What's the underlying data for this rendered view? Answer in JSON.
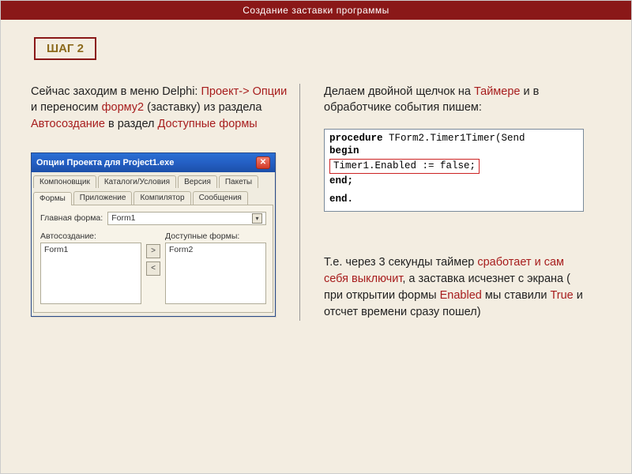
{
  "header": {
    "title": "Создание заставки программы"
  },
  "step": {
    "label": "ШАГ 2"
  },
  "left": {
    "p1": {
      "t0": " Сейчас заходим в меню Delphi: ",
      "k1": "Проект-> Опции",
      "t1": " и переносим ",
      "k2": "форму2",
      "t2": " (заставку) из раздела ",
      "k3": "Автосоздание",
      "t3": " в раздел ",
      "k4": "Доступные формы"
    },
    "dialog": {
      "title": "Опции Проекта для Project1.exe",
      "tabs_row1": [
        "Компоновщик",
        "Каталоги/Условия",
        "Версия",
        "Пакеты"
      ],
      "tabs_row2": [
        "Формы",
        "Приложение",
        "Компилятор",
        "Сообщения"
      ],
      "main_form_label": "Главная форма:",
      "main_form_value": "Form1",
      "autocreate_label": "Автосоздание:",
      "available_label": "Доступные формы:",
      "autocreate_items": [
        "Form1"
      ],
      "available_items": [
        "Form2"
      ],
      "move_right": ">",
      "move_left": "<"
    }
  },
  "right": {
    "p1": {
      "t0": "Делаем двойной щелчок на ",
      "k1": "Таймере",
      "t1": " и в обработчике события пишем:"
    },
    "code": {
      "l1a": "procedure",
      "l1b": " TForm2.Timer1Timer(Send",
      "l2": "begin",
      "hl": "Timer1.Enabled := false;",
      "l3": "end;",
      "l4": "end."
    },
    "explain": {
      "t0": "  Т.е. через 3 секунды таймер ",
      "k1": "сработает и сам себя выключит",
      "t1": ", а заставка исчезнет с экрана ( при открытии формы ",
      "k2": "Enabled",
      "t2": " мы ставили ",
      "k3": "True",
      "t3": "  и отсчет времени сразу пошел)"
    }
  }
}
